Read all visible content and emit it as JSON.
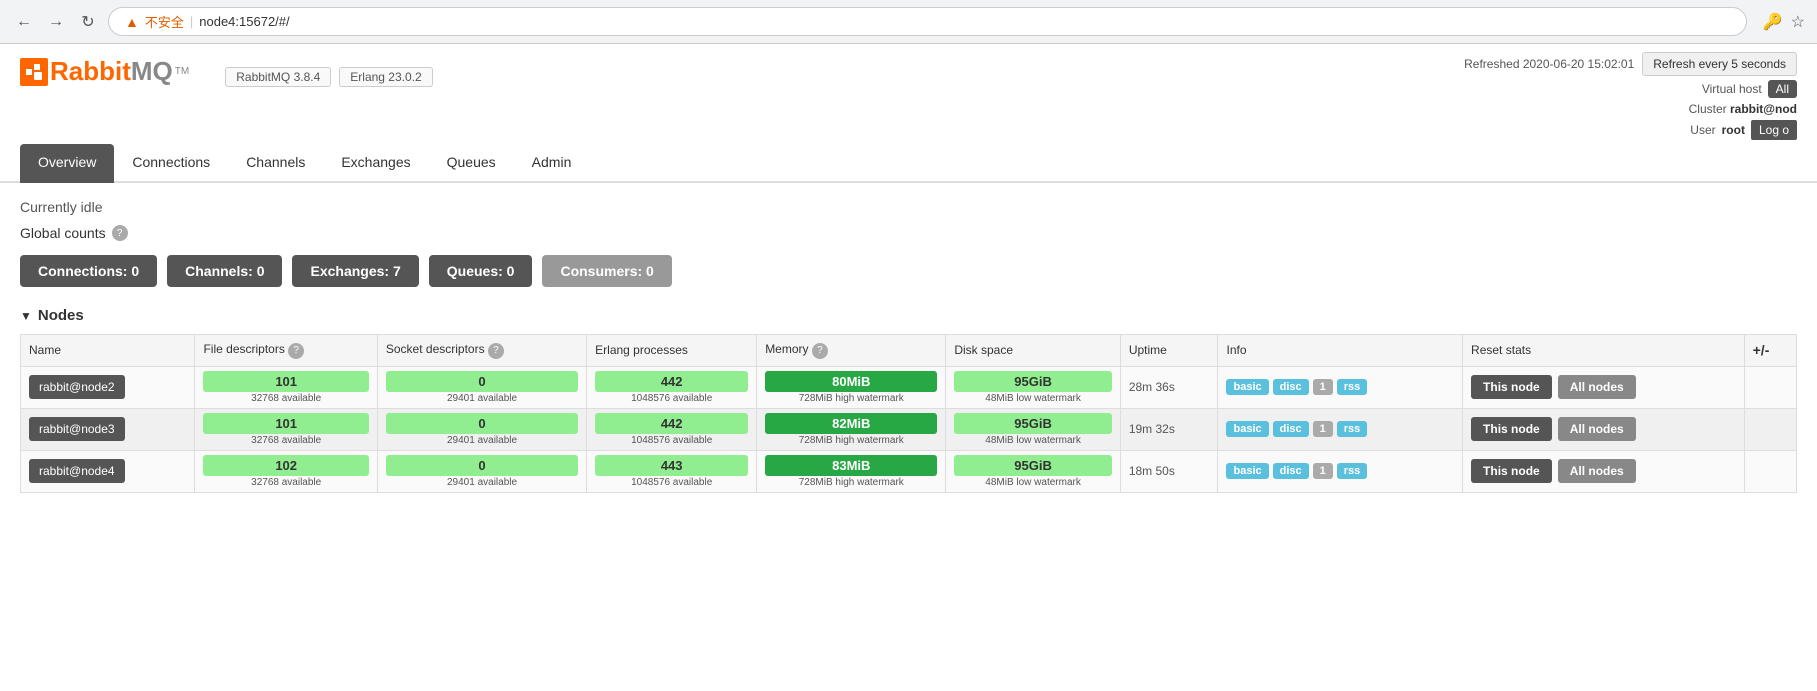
{
  "browser": {
    "back_btn": "←",
    "forward_btn": "→",
    "reload_btn": "↻",
    "warning_icon": "▲",
    "insecure_label": "不安全",
    "address": "node4:15672/#/",
    "key_icon": "🔑",
    "star_icon": "☆"
  },
  "header": {
    "logo_rabbit": "Rabbit",
    "logo_mq": "MQ",
    "logo_tm": "TM",
    "rabbitmq_version_label": "RabbitMQ 3.8.4",
    "erlang_version_label": "Erlang 23.0.2",
    "refreshed_label": "Refreshed 2020-06-20 15:02:01",
    "refresh_btn_label": "Refresh every 5 seconds",
    "vhost_label": "Virtual host",
    "vhost_value": "All",
    "cluster_label": "Cluster",
    "cluster_value": "rabbit@nod",
    "user_label": "User",
    "user_value": "root",
    "logout_label": "Log o"
  },
  "nav": {
    "items": [
      {
        "id": "overview",
        "label": "Overview",
        "active": true
      },
      {
        "id": "connections",
        "label": "Connections",
        "active": false
      },
      {
        "id": "channels",
        "label": "Channels",
        "active": false
      },
      {
        "id": "exchanges",
        "label": "Exchanges",
        "active": false
      },
      {
        "id": "queues",
        "label": "Queues",
        "active": false
      },
      {
        "id": "admin",
        "label": "Admin",
        "active": false
      }
    ]
  },
  "main": {
    "status": "Currently idle",
    "global_counts_label": "Global counts",
    "help_icon": "?",
    "counts": [
      {
        "id": "connections",
        "label": "Connections: 0",
        "style": "dark"
      },
      {
        "id": "channels",
        "label": "Channels: 0",
        "style": "dark"
      },
      {
        "id": "exchanges",
        "label": "Exchanges: 7",
        "style": "dark"
      },
      {
        "id": "queues",
        "label": "Queues: 0",
        "style": "dark"
      },
      {
        "id": "consumers",
        "label": "Consumers: 0",
        "style": "gray"
      }
    ],
    "nodes_section": {
      "collapse_arrow": "▼",
      "title": "Nodes",
      "table": {
        "headers": [
          {
            "id": "name",
            "label": "Name"
          },
          {
            "id": "file_desc",
            "label": "File descriptors",
            "help": "?"
          },
          {
            "id": "socket_desc",
            "label": "Socket descriptors",
            "help": "?"
          },
          {
            "id": "erlang_proc",
            "label": "Erlang processes"
          },
          {
            "id": "memory",
            "label": "Memory",
            "help": "?"
          },
          {
            "id": "disk_space",
            "label": "Disk space"
          },
          {
            "id": "uptime",
            "label": "Uptime"
          },
          {
            "id": "info",
            "label": "Info"
          },
          {
            "id": "reset_stats",
            "label": "Reset stats"
          },
          {
            "id": "plus_minus",
            "label": "+/-"
          }
        ],
        "rows": [
          {
            "name": "rabbit@node2",
            "file_desc_value": "101",
            "file_desc_available": "32768 available",
            "socket_desc_value": "0",
            "socket_desc_available": "29401 available",
            "erlang_proc_value": "442",
            "erlang_proc_available": "1048576 available",
            "memory_value": "80MiB",
            "memory_watermark": "728MiB high watermark",
            "disk_value": "95GiB",
            "disk_watermark": "48MiB low watermark",
            "uptime": "28m 36s",
            "badges": [
              "basic",
              "disc",
              "1",
              "rss"
            ],
            "this_node_label": "This node",
            "all_nodes_label": "All nodes"
          },
          {
            "name": "rabbit@node3",
            "file_desc_value": "101",
            "file_desc_available": "32768 available",
            "socket_desc_value": "0",
            "socket_desc_available": "29401 available",
            "erlang_proc_value": "442",
            "erlang_proc_available": "1048576 available",
            "memory_value": "82MiB",
            "memory_watermark": "728MiB high watermark",
            "disk_value": "95GiB",
            "disk_watermark": "48MiB low watermark",
            "uptime": "19m 32s",
            "badges": [
              "basic",
              "disc",
              "1",
              "rss"
            ],
            "this_node_label": "This node",
            "all_nodes_label": "All nodes"
          },
          {
            "name": "rabbit@node4",
            "file_desc_value": "102",
            "file_desc_available": "32768 available",
            "socket_desc_value": "0",
            "socket_desc_available": "29401 available",
            "erlang_proc_value": "443",
            "erlang_proc_available": "1048576 available",
            "memory_value": "83MiB",
            "memory_watermark": "728MiB high watermark",
            "disk_value": "95GiB",
            "disk_watermark": "48MiB low watermark",
            "uptime": "18m 50s",
            "badges": [
              "basic",
              "disc",
              "1",
              "rss"
            ],
            "this_node_label": "This node",
            "all_nodes_label": "All nodes"
          }
        ]
      }
    }
  }
}
